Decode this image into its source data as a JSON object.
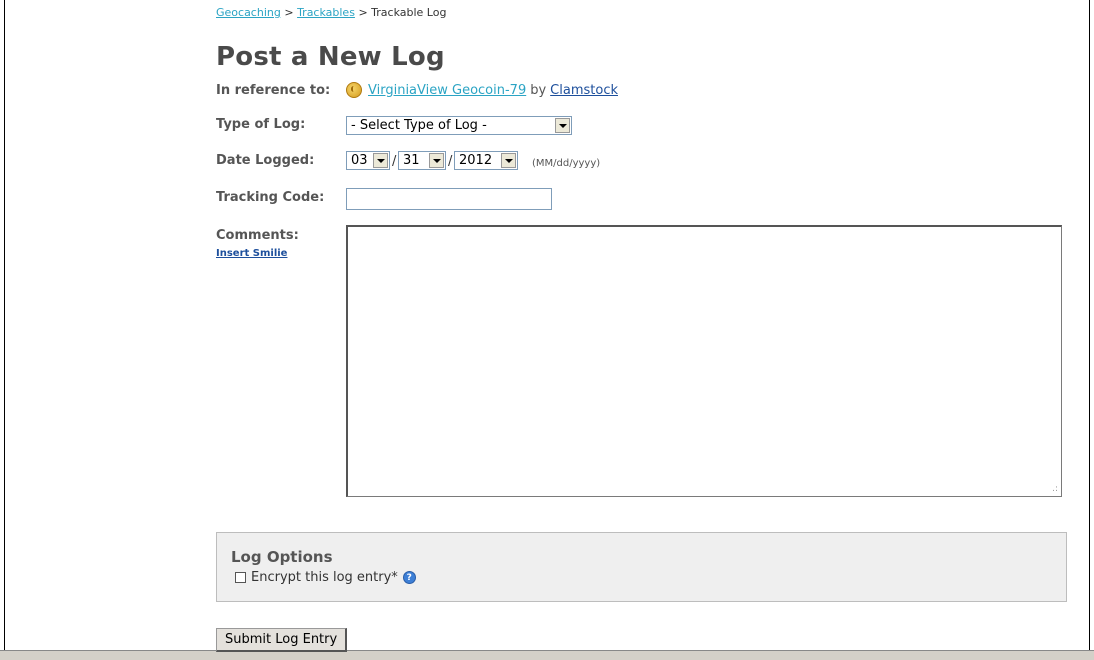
{
  "breadcrumb": {
    "link1": "Geocaching",
    "sep1": ">",
    "link2": "Trackables",
    "sep2": ">",
    "current": "Trackable Log"
  },
  "page_title": "Post a New Log",
  "reference": {
    "label": "In reference to:",
    "item_name": "VirginiaView Geocoin-79",
    "by": "by",
    "owner": "Clamstock"
  },
  "log_type": {
    "label": "Type of Log:",
    "selected": "- Select Type of Log -"
  },
  "date_logged": {
    "label": "Date Logged:",
    "month": "03",
    "day": "31",
    "year": "2012",
    "sep": "/",
    "format_hint": "(MM/dd/yyyy)"
  },
  "tracking_code": {
    "label": "Tracking Code:",
    "value": ""
  },
  "comments": {
    "label": "Comments:",
    "insert_smilie": "Insert Smilie",
    "value": ""
  },
  "log_options": {
    "heading": "Log Options",
    "encrypt_label": "Encrypt this log entry*",
    "encrypt_checked": false,
    "help_glyph": "?"
  },
  "submit_label": "Submit Log Entry",
  "icons": {
    "coin": "geocoin-icon",
    "help": "help-icon"
  },
  "colors": {
    "link": "#2ba4c4",
    "owner_link": "#1d4f9c",
    "options_bg": "#efefef"
  }
}
